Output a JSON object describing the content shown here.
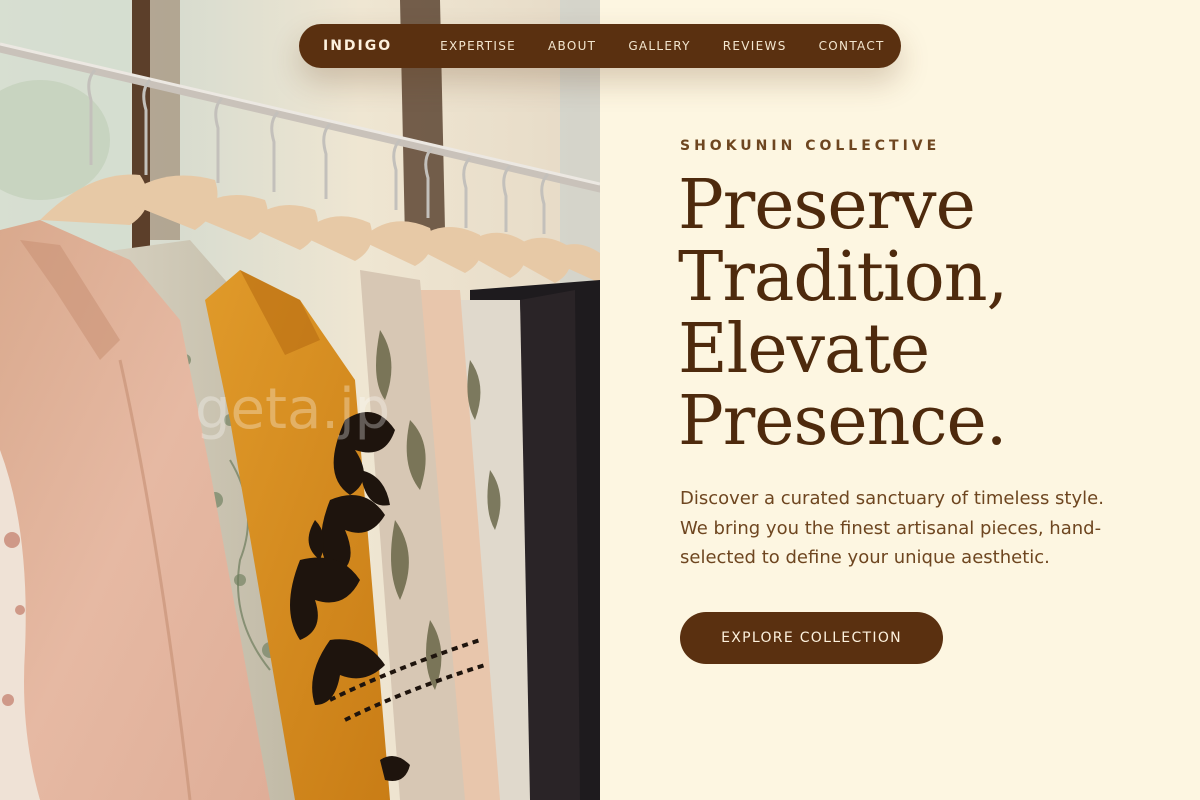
{
  "nav": {
    "brand": "INDIGO",
    "links": [
      "EXPERTISE",
      "ABOUT",
      "GALLERY",
      "REVIEWS",
      "CONTACT"
    ]
  },
  "hero": {
    "eyebrow": "SHOKUNIN COLLECTIVE",
    "headline_lines": [
      "Preserve",
      "Tradition,",
      "Elevate",
      "Presence."
    ],
    "lead": "Discover a curated sanctuary of timeless style. We bring you the finest artisanal pieces, hand-selected to define your unique aesthetic.",
    "cta_label": "EXPLORE COLLECTION"
  },
  "image": {
    "subject": "clothing-rack-photo",
    "watermark": "geta.jp"
  },
  "colors": {
    "background": "#fdf6e1",
    "accent": "#5a3010",
    "heading": "#4e2a0d",
    "body_text": "#6e4620"
  }
}
